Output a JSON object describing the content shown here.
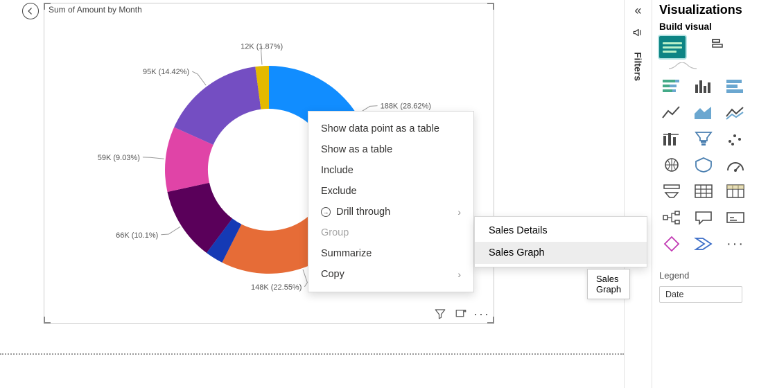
{
  "visual": {
    "title": "Sum of Amount by Month"
  },
  "chart_data": {
    "type": "donut",
    "metric": "Sum of Amount",
    "dimension": "Month",
    "slices": [
      {
        "label": "188K (28.62%)",
        "value_k": 188,
        "percent": 28.62,
        "color": "#118dff"
      },
      {
        "label": "148K (22.55%)",
        "value_k": 148,
        "percent": 22.55,
        "color": "#e66c37",
        "hidden_gap_percent": 2.5,
        "hidden_gap_color": "#153ab5"
      },
      {
        "label": "66K (10.1%)",
        "value_k": 66,
        "percent": 10.1,
        "color": "#5a005a"
      },
      {
        "label": "59K (9.03%)",
        "value_k": 59,
        "percent": 9.03,
        "color": "#e044a7"
      },
      {
        "label": "95K (14.42%)",
        "value_k": 95,
        "percent": 14.42,
        "color": "#744ec2"
      },
      {
        "label": "12K (1.87%)",
        "value_k": 12,
        "percent": 1.87,
        "color": "#e3b900"
      }
    ]
  },
  "context_menu": {
    "items": [
      {
        "label": "Show data point as a table",
        "disabled": false,
        "has_submenu": false,
        "has_icon": false
      },
      {
        "label": "Show as a table",
        "disabled": false,
        "has_submenu": false,
        "has_icon": false
      },
      {
        "label": "Include",
        "disabled": false,
        "has_submenu": false,
        "has_icon": false
      },
      {
        "label": "Exclude",
        "disabled": false,
        "has_submenu": false,
        "has_icon": false
      },
      {
        "label": "Drill through",
        "disabled": false,
        "has_submenu": true,
        "has_icon": true
      },
      {
        "label": "Group",
        "disabled": true,
        "has_submenu": false,
        "has_icon": false
      },
      {
        "label": "Summarize",
        "disabled": false,
        "has_submenu": false,
        "has_icon": false
      },
      {
        "label": "Copy",
        "disabled": false,
        "has_submenu": true,
        "has_icon": false
      }
    ],
    "drill_submenu": [
      {
        "label": "Sales Details",
        "hover": false
      },
      {
        "label": "Sales Graph",
        "hover": true
      }
    ],
    "tooltip": "Sales Graph"
  },
  "filters_panel": {
    "label": "Filters"
  },
  "viz_panel": {
    "title": "Visualizations",
    "build_label": "Build visual",
    "legend_label": "Legend",
    "field": "Date"
  }
}
